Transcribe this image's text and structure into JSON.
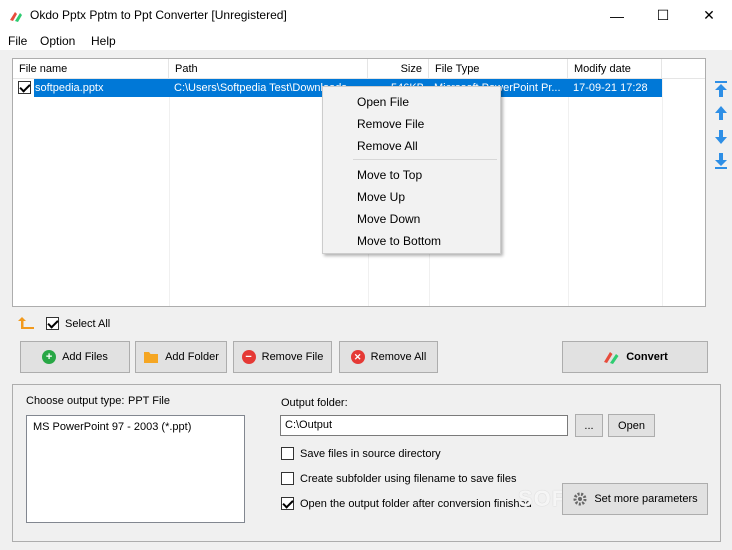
{
  "window": {
    "title": "Okdo Pptx Pptm to Ppt Converter [Unregistered]",
    "controls": {
      "minimize": "—",
      "maximize": "☐",
      "close": "✕"
    }
  },
  "menu": [
    "File",
    "Option",
    "Help"
  ],
  "file_list": {
    "columns": [
      "File name",
      "Path",
      "Size",
      "File Type",
      "Modify date"
    ],
    "rows": [
      {
        "checked": true,
        "name": "softpedia.pptx",
        "path": "C:\\Users\\Softpedia Test\\Downloads",
        "size": "546KB",
        "type": "Microsoft PowerPoint Pr...",
        "date": "17-09-21 17:28"
      }
    ]
  },
  "context_menu": [
    "Open File",
    "Remove File",
    "Remove All",
    "Move to Top",
    "Move Up",
    "Move Down",
    "Move to Bottom"
  ],
  "select_all": {
    "label": "Select All",
    "checked": true
  },
  "buttons": {
    "add_files": "Add Files",
    "add_folder": "Add Folder",
    "remove_file": "Remove File",
    "remove_all": "Remove All",
    "convert": "Convert"
  },
  "output": {
    "type_label": "Choose output type:",
    "type_value": "PPT File",
    "type_options": [
      "MS PowerPoint 97 - 2003 (*.ppt)"
    ],
    "folder_label": "Output folder:",
    "folder_value": "C:\\Output",
    "browse": "...",
    "open": "Open",
    "options": [
      {
        "label": "Save files in source directory",
        "checked": false
      },
      {
        "label": "Create subfolder using filename to save files",
        "checked": false
      },
      {
        "label": "Open the output folder after conversion finished",
        "checked": true
      }
    ],
    "set_params": "Set more parameters"
  },
  "watermark": "SOFTPEDIA",
  "colors": {
    "selection": "#0078d7",
    "arrow_blue": "#2e8fe6",
    "orange": "#f29a1d",
    "green": "#28a745",
    "red": "#e53935"
  }
}
